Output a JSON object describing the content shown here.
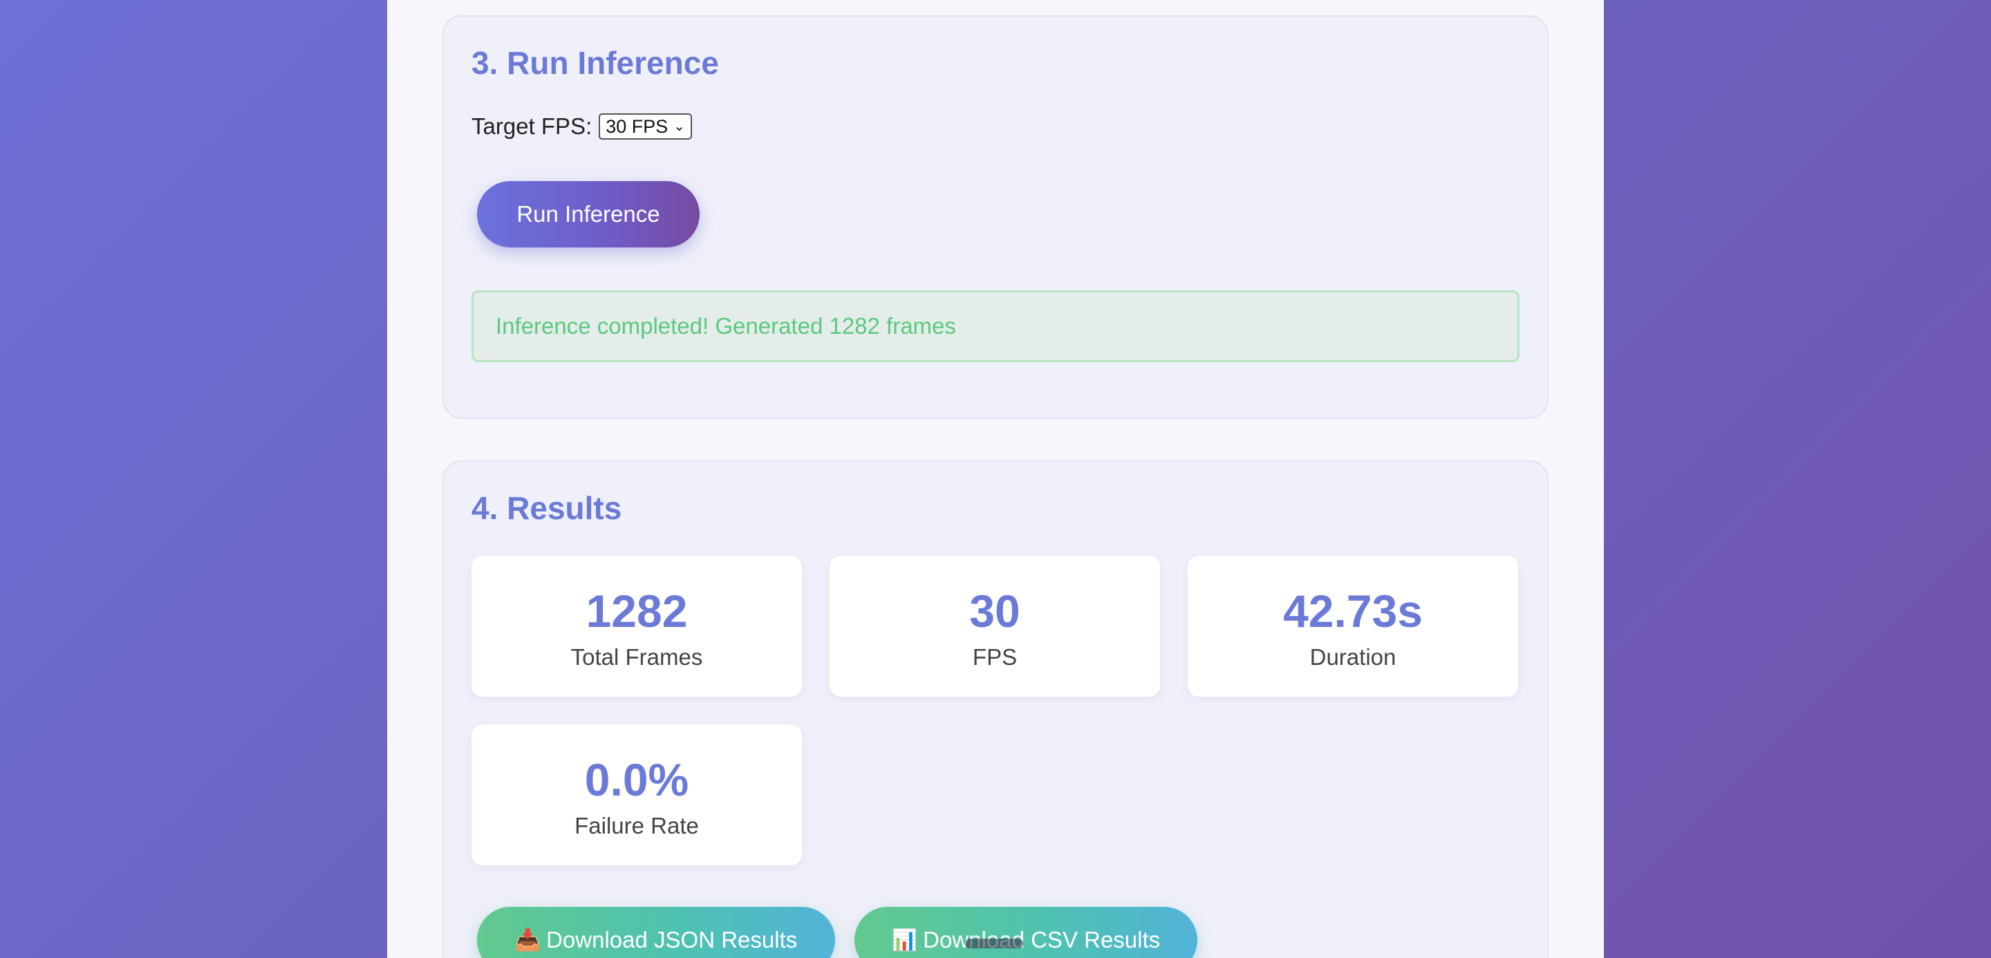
{
  "section3": {
    "title": "3. Run Inference",
    "fps_label": "Target FPS:",
    "fps_selected": "30 FPS",
    "run_button": "Run Inference",
    "status_message": "Inference completed! Generated 1282 frames"
  },
  "section4": {
    "title": "4. Results",
    "stats": [
      {
        "value": "1282",
        "label": "Total Frames"
      },
      {
        "value": "30",
        "label": "FPS"
      },
      {
        "value": "42.73s",
        "label": "Duration"
      },
      {
        "value": "0.0%",
        "label": "Failure Rate"
      }
    ],
    "download_json": {
      "icon": "📥",
      "label": "Download JSON Results"
    },
    "download_csv": {
      "icon": "📊",
      "label": "Download CSV Results"
    }
  },
  "colors": {
    "accent": "#6b7ad6",
    "success_text": "#5bc97f",
    "success_bg": "#e4ede9"
  }
}
